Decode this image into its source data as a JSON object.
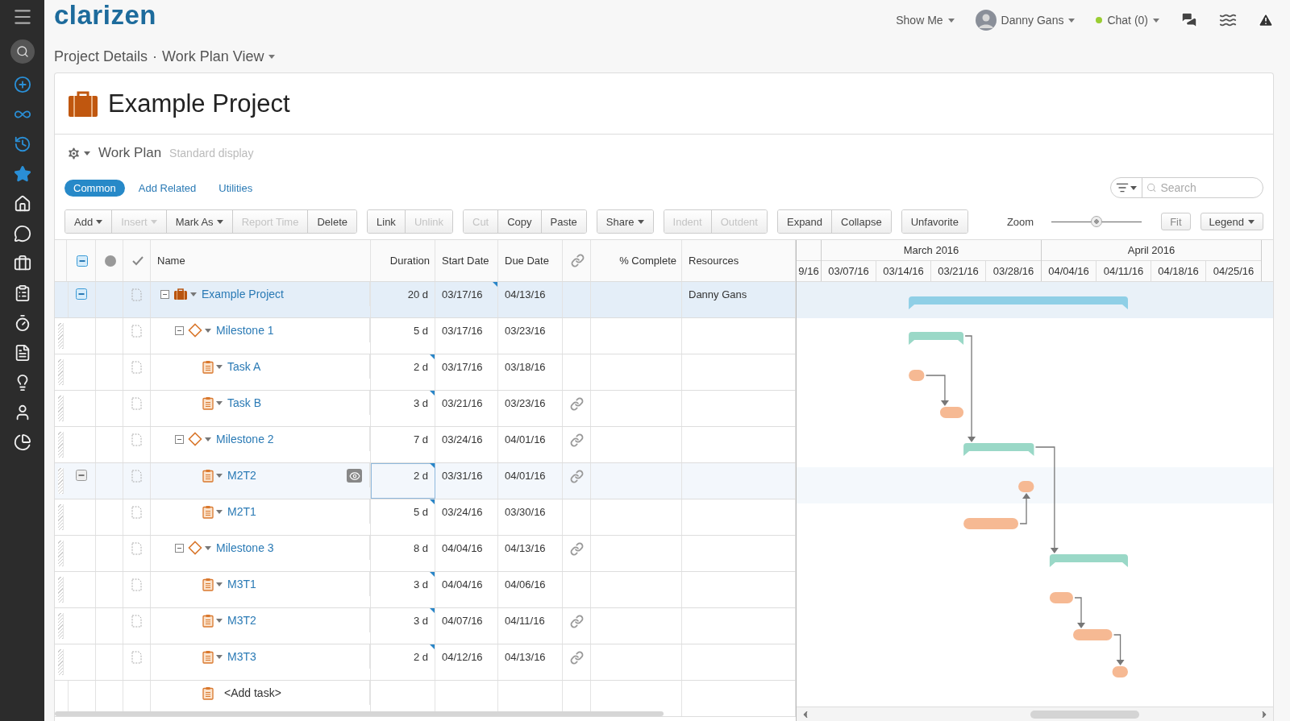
{
  "logo": "clarizen",
  "top_menu": {
    "show_me": "Show Me",
    "user": "Danny Gans",
    "chat": "Chat (0)",
    "chat_online": true
  },
  "breadcrumb": {
    "parent": "Project Details",
    "separator": "·",
    "current": "Work Plan View"
  },
  "title": "Example Project",
  "section": {
    "title": "Work Plan",
    "subtitle": "Standard display"
  },
  "tabs": [
    {
      "label": "Common",
      "selected": true
    },
    {
      "label": "Add Related",
      "selected": false
    },
    {
      "label": "Utilities",
      "selected": false
    }
  ],
  "search": {
    "placeholder": "Search"
  },
  "toolbar": [
    [
      {
        "label": "Add",
        "dropdown": true,
        "disabled": false
      },
      {
        "label": "Insert",
        "dropdown": true,
        "disabled": true
      },
      {
        "label": "Mark As",
        "dropdown": true,
        "disabled": false
      },
      {
        "label": "Report Time",
        "dropdown": false,
        "disabled": true
      },
      {
        "label": "Delete",
        "dropdown": false,
        "disabled": false
      }
    ],
    [
      {
        "label": "Link",
        "dropdown": false,
        "disabled": false
      },
      {
        "label": "Unlink",
        "dropdown": false,
        "disabled": true
      }
    ],
    [
      {
        "label": "Cut",
        "dropdown": false,
        "disabled": true
      },
      {
        "label": "Copy",
        "dropdown": false,
        "disabled": false
      },
      {
        "label": "Paste",
        "dropdown": false,
        "disabled": false
      }
    ],
    [
      {
        "label": "Share",
        "dropdown": true,
        "disabled": false
      }
    ],
    [
      {
        "label": "Indent",
        "dropdown": false,
        "disabled": true
      },
      {
        "label": "Outdent",
        "dropdown": false,
        "disabled": true
      }
    ],
    [
      {
        "label": "Expand",
        "dropdown": false,
        "disabled": false
      },
      {
        "label": "Collapse",
        "dropdown": false,
        "disabled": false
      }
    ],
    [
      {
        "label": "Unfavorite",
        "dropdown": false,
        "disabled": false
      }
    ]
  ],
  "zoom": {
    "label": "Zoom",
    "level": 0.5
  },
  "fit_button": "Fit",
  "legend_button": "Legend",
  "table": {
    "header_checkbox_partial": true,
    "columns": [
      {
        "kind": "checkbox"
      },
      {
        "kind": "dot"
      },
      {
        "kind": "check"
      },
      {
        "kind": "text",
        "label": "Name"
      },
      {
        "kind": "text",
        "label": "Duration"
      },
      {
        "kind": "text",
        "label": "Start Date"
      },
      {
        "kind": "text",
        "label": "Due Date"
      },
      {
        "kind": "link"
      },
      {
        "kind": "text",
        "label": "% Complete"
      },
      {
        "kind": "text",
        "label": "Resources"
      }
    ],
    "rows": [
      {
        "name": "Example Project",
        "kind": "project",
        "expanded": true,
        "duration": "20 d",
        "start": "03/17/16",
        "due": "04/13/16",
        "linked": false,
        "resources": "Danny Gans",
        "selected": true,
        "hovered": false,
        "duration_flag": false,
        "start_flag": true,
        "duration_focused": false,
        "children": [
          {
            "name": "Milestone 1",
            "kind": "milestone",
            "expanded": true,
            "duration": "5 d",
            "start": "03/17/16",
            "due": "03/23/16",
            "linked": false,
            "selected": false,
            "hovered": false,
            "duration_flag": false,
            "start_flag": false,
            "duration_focused": false,
            "children": [
              {
                "name": "Task A",
                "kind": "task",
                "duration": "2 d",
                "start": "03/17/16",
                "due": "03/18/16",
                "linked": false,
                "selected": false,
                "hovered": false,
                "duration_flag": true,
                "start_flag": false,
                "duration_focused": false
              },
              {
                "name": "Task B",
                "kind": "task",
                "duration": "3 d",
                "start": "03/21/16",
                "due": "03/23/16",
                "linked": true,
                "selected": false,
                "hovered": false,
                "duration_flag": true,
                "start_flag": false,
                "duration_focused": false
              }
            ]
          },
          {
            "name": "Milestone 2",
            "kind": "milestone",
            "expanded": true,
            "duration": "7 d",
            "start": "03/24/16",
            "due": "04/01/16",
            "linked": true,
            "selected": false,
            "hovered": false,
            "duration_flag": false,
            "start_flag": false,
            "duration_focused": false,
            "children": [
              {
                "name": "M2T2",
                "kind": "task",
                "duration": "2 d",
                "start": "03/31/16",
                "due": "04/01/16",
                "linked": true,
                "selected": false,
                "hovered": true,
                "duration_flag": true,
                "start_flag": false,
                "duration_focused": true
              },
              {
                "name": "M2T1",
                "kind": "task",
                "duration": "5 d",
                "start": "03/24/16",
                "due": "03/30/16",
                "linked": false,
                "selected": false,
                "hovered": false,
                "duration_flag": true,
                "start_flag": false,
                "duration_focused": false
              }
            ]
          },
          {
            "name": "Milestone 3",
            "kind": "milestone",
            "expanded": true,
            "duration": "8 d",
            "start": "04/04/16",
            "due": "04/13/16",
            "linked": true,
            "selected": false,
            "hovered": false,
            "duration_flag": false,
            "start_flag": false,
            "duration_focused": false,
            "children": [
              {
                "name": "M3T1",
                "kind": "task",
                "duration": "3 d",
                "start": "04/04/16",
                "due": "04/06/16",
                "linked": false,
                "selected": false,
                "hovered": false,
                "duration_flag": true,
                "start_flag": false,
                "duration_focused": false
              },
              {
                "name": "M3T2",
                "kind": "task",
                "duration": "3 d",
                "start": "04/07/16",
                "due": "04/11/16",
                "linked": true,
                "selected": false,
                "hovered": false,
                "duration_flag": true,
                "start_flag": false,
                "duration_focused": false
              },
              {
                "name": "M3T3",
                "kind": "task",
                "duration": "2 d",
                "start": "04/12/16",
                "due": "04/13/16",
                "linked": true,
                "selected": false,
                "hovered": false,
                "duration_flag": true,
                "start_flag": false,
                "duration_focused": false
              }
            ]
          }
        ]
      }
    ],
    "add_row": "<Add task>"
  },
  "gantt": {
    "months": [
      {
        "weeks": [
          "9/16"
        ]
      },
      {
        "label": "March 2016",
        "weeks": [
          "03/07/16",
          "03/14/16",
          "03/21/16",
          "03/28/16"
        ]
      },
      {
        "label": "April 2016",
        "weeks": [
          "04/04/16",
          "04/11/16",
          "04/18/16",
          "04/25/16"
        ]
      }
    ]
  }
}
